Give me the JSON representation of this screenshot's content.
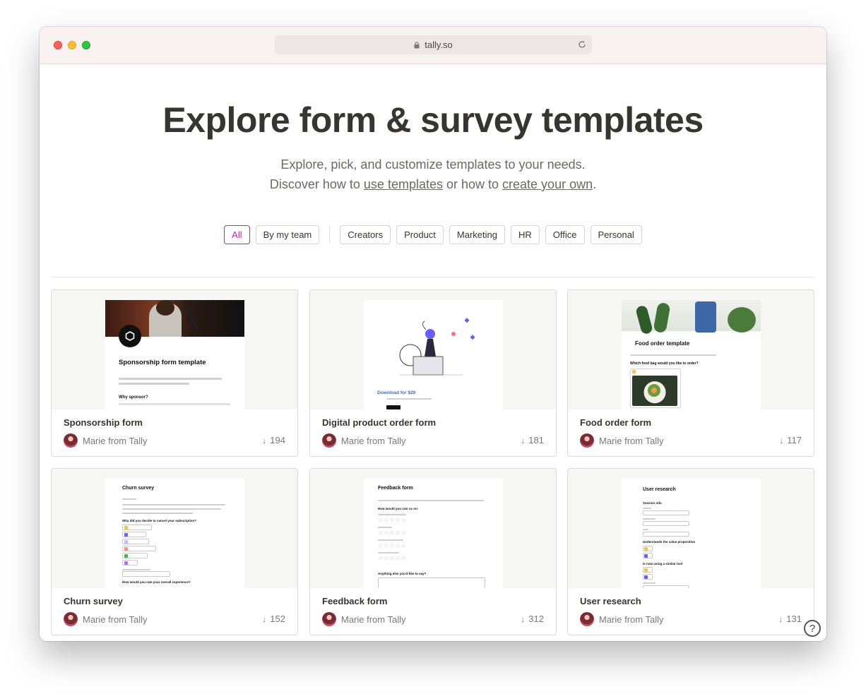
{
  "browser": {
    "url": "tally.so"
  },
  "hero": {
    "title": "Explore form & survey templates",
    "sub_line1": "Explore, pick, and customize templates to your needs.",
    "sub_line2_prefix": "Discover how to ",
    "sub_link1": "use templates",
    "sub_line2_mid": " or how to ",
    "sub_link2": "create your own",
    "sub_line2_suffix": "."
  },
  "filters": [
    "All",
    "By my team",
    "Creators",
    "Product",
    "Marketing",
    "HR",
    "Office",
    "Personal"
  ],
  "cards": [
    {
      "title": "Sponsorship form",
      "author": "Marie from Tally",
      "downloads": "194",
      "preview": {
        "heading": "Sponsorship form template",
        "q": "Why sponsor?"
      }
    },
    {
      "title": "Digital product order form",
      "author": "Marie from Tally",
      "downloads": "181",
      "preview": {
        "heading": "Download for $29"
      }
    },
    {
      "title": "Food order form",
      "author": "Marie from Tally",
      "downloads": "117",
      "preview": {
        "heading": "Food order template",
        "q": "Which food bag would you like to order?"
      }
    },
    {
      "title": "Churn survey",
      "author": "Marie from Tally",
      "downloads": "152",
      "preview": {
        "heading": "Churn survey",
        "q": "Why did you decide to cancel your subscription?",
        "q2": "How would you rate your overall experience?"
      }
    },
    {
      "title": "Feedback form",
      "author": "Marie from Tally",
      "downloads": "312",
      "preview": {
        "heading": "Feedback form",
        "q": "How would you rate us on:",
        "q2": "Anything else you'd like to say?"
      }
    },
    {
      "title": "User research",
      "author": "Marie from Tally",
      "downloads": "131",
      "preview": {
        "heading": "User research",
        "q": "Session info",
        "q2": "Understands the value proposition",
        "q3": "Is now using a similar tool"
      }
    }
  ],
  "help": {
    "label": "?"
  },
  "colors": {
    "accent": "#c21fb5",
    "text": "#37352f",
    "muted": "#6b6966"
  }
}
